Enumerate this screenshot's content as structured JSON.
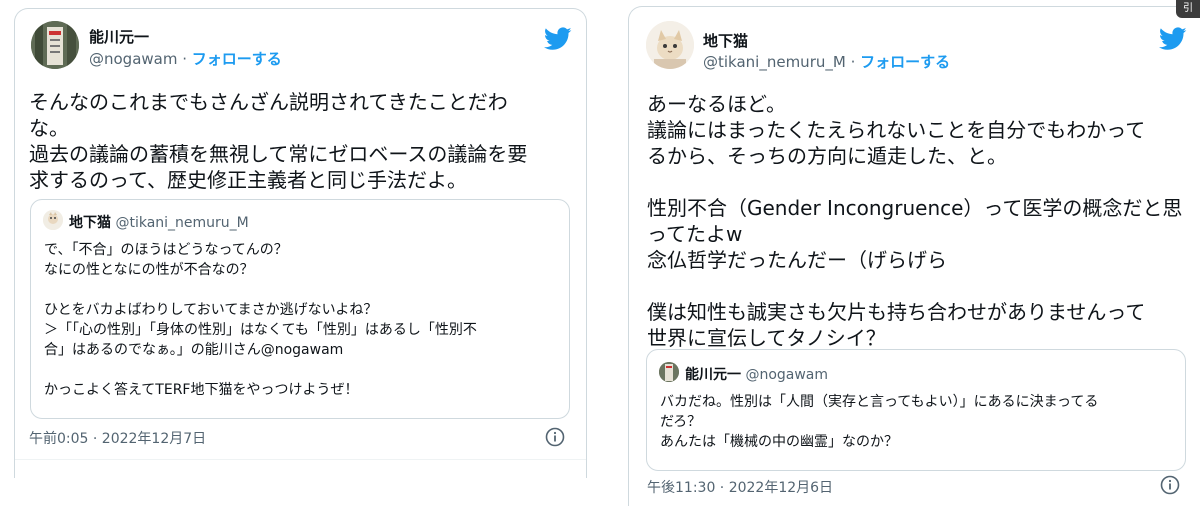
{
  "left_tweet": {
    "author_name": "能川元一",
    "handle": "@nogawam",
    "separator": " · ",
    "follow_label": "フォローする",
    "text_lines": [
      "そんなのこれまでもさんざん説明されてきたことだわ",
      "な。",
      "過去の議論の蓄積を無視して常にゼロベースの議論を要",
      "求するのって、歴史修正主義者と同じ手法だよ。"
    ],
    "quote": {
      "author_name": "地下猫",
      "handle": "@tikani_nemuru_M",
      "lines": [
        "で、「不合」のほうはどうなってんの？",
        "なにの性となにの性が不合なの？",
        "",
        "ひとをバカよばわりしておいてまさか逃げないよね？",
        "＞「「心の性別」「身体の性別」はなくても「性別」はあるし「性別不",
        "合」はあるのでなぁ。」の能川さん@nogawam",
        "",
        "かっこよく答えてTERF地下猫をやっつけようぜ！"
      ]
    },
    "timestamp": "午前0:05 · 2022年12月7日",
    "icons": {
      "brand": "twitter-bird-icon",
      "info": "info-icon"
    }
  },
  "right_tweet": {
    "author_name": "地下猫",
    "handle": "@tikani_nemuru_M",
    "separator": " · ",
    "follow_label": "フォローする",
    "text_lines": [
      "あーなるほど。",
      "議論にはまったくたえられないことを自分でもわかって",
      "るから、そっちの方向に遁走した、と。",
      "",
      "性別不合（Gender Incongruence）って医学の概念だと思",
      "ってたよw",
      "念仏哲学だったんだー（げらげら",
      "",
      "僕は知性も誠実さも欠片も持ち合わせがありませんって",
      "世界に宣伝してタノシイ？"
    ],
    "quote": {
      "author_name": "能川元一",
      "handle": "@nogawam",
      "lines": [
        "バカだね。性別は「人間（実存と言ってもよい）」にあるに決まってる",
        "だろ？",
        "あんたは「機械の中の幽霊」なのか？"
      ]
    },
    "timestamp": "午後11:30 · 2022年12月6日",
    "icons": {
      "brand": "twitter-bird-icon",
      "info": "info-icon"
    }
  },
  "corner_badge": "引",
  "colors": {
    "accent": "#1d9bf0",
    "secondary_text": "#536471",
    "border": "#cfd9de"
  }
}
